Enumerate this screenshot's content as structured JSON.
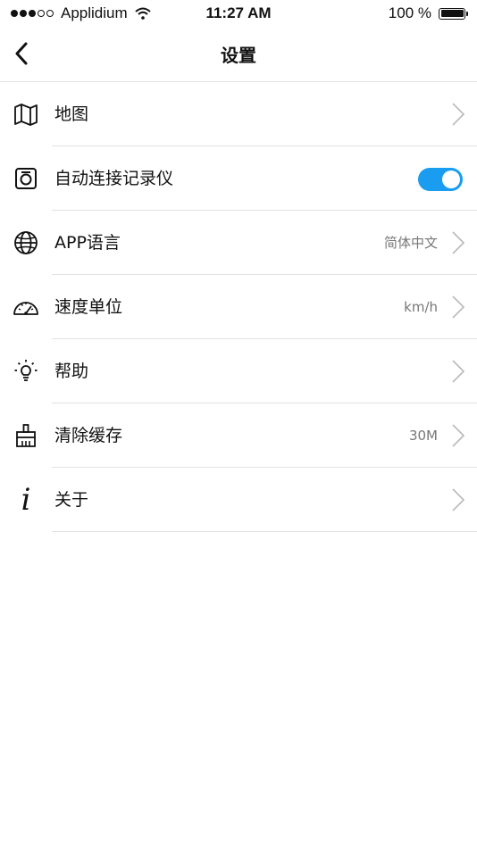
{
  "status_bar": {
    "carrier": "Applidium",
    "time": "11:27 AM",
    "battery": "100 %",
    "signal_icon": "signal-dots-icon",
    "wifi_icon": "wifi-icon",
    "battery_icon": "battery-icon"
  },
  "nav": {
    "title": "设置",
    "back_icon": "chevron-left-icon"
  },
  "settings": {
    "items": [
      {
        "label": "地图",
        "icon": "map-icon"
      },
      {
        "label": "自动连接记录仪",
        "icon": "camera-icon",
        "toggle_on": true
      },
      {
        "label": "APP语言",
        "value": "简体中文",
        "icon": "globe-icon"
      },
      {
        "label": "速度单位",
        "value": "km/h",
        "icon": "speedometer-icon"
      },
      {
        "label": "帮助",
        "icon": "lightbulb-icon"
      },
      {
        "label": "清除缓存",
        "value": "30M",
        "icon": "broom-icon"
      },
      {
        "label": "关于",
        "icon": "info-icon",
        "glyph": "i"
      }
    ]
  },
  "colors": {
    "accent": "#1a9df0",
    "divider": "#e2e2e2",
    "value_text": "#777777"
  }
}
